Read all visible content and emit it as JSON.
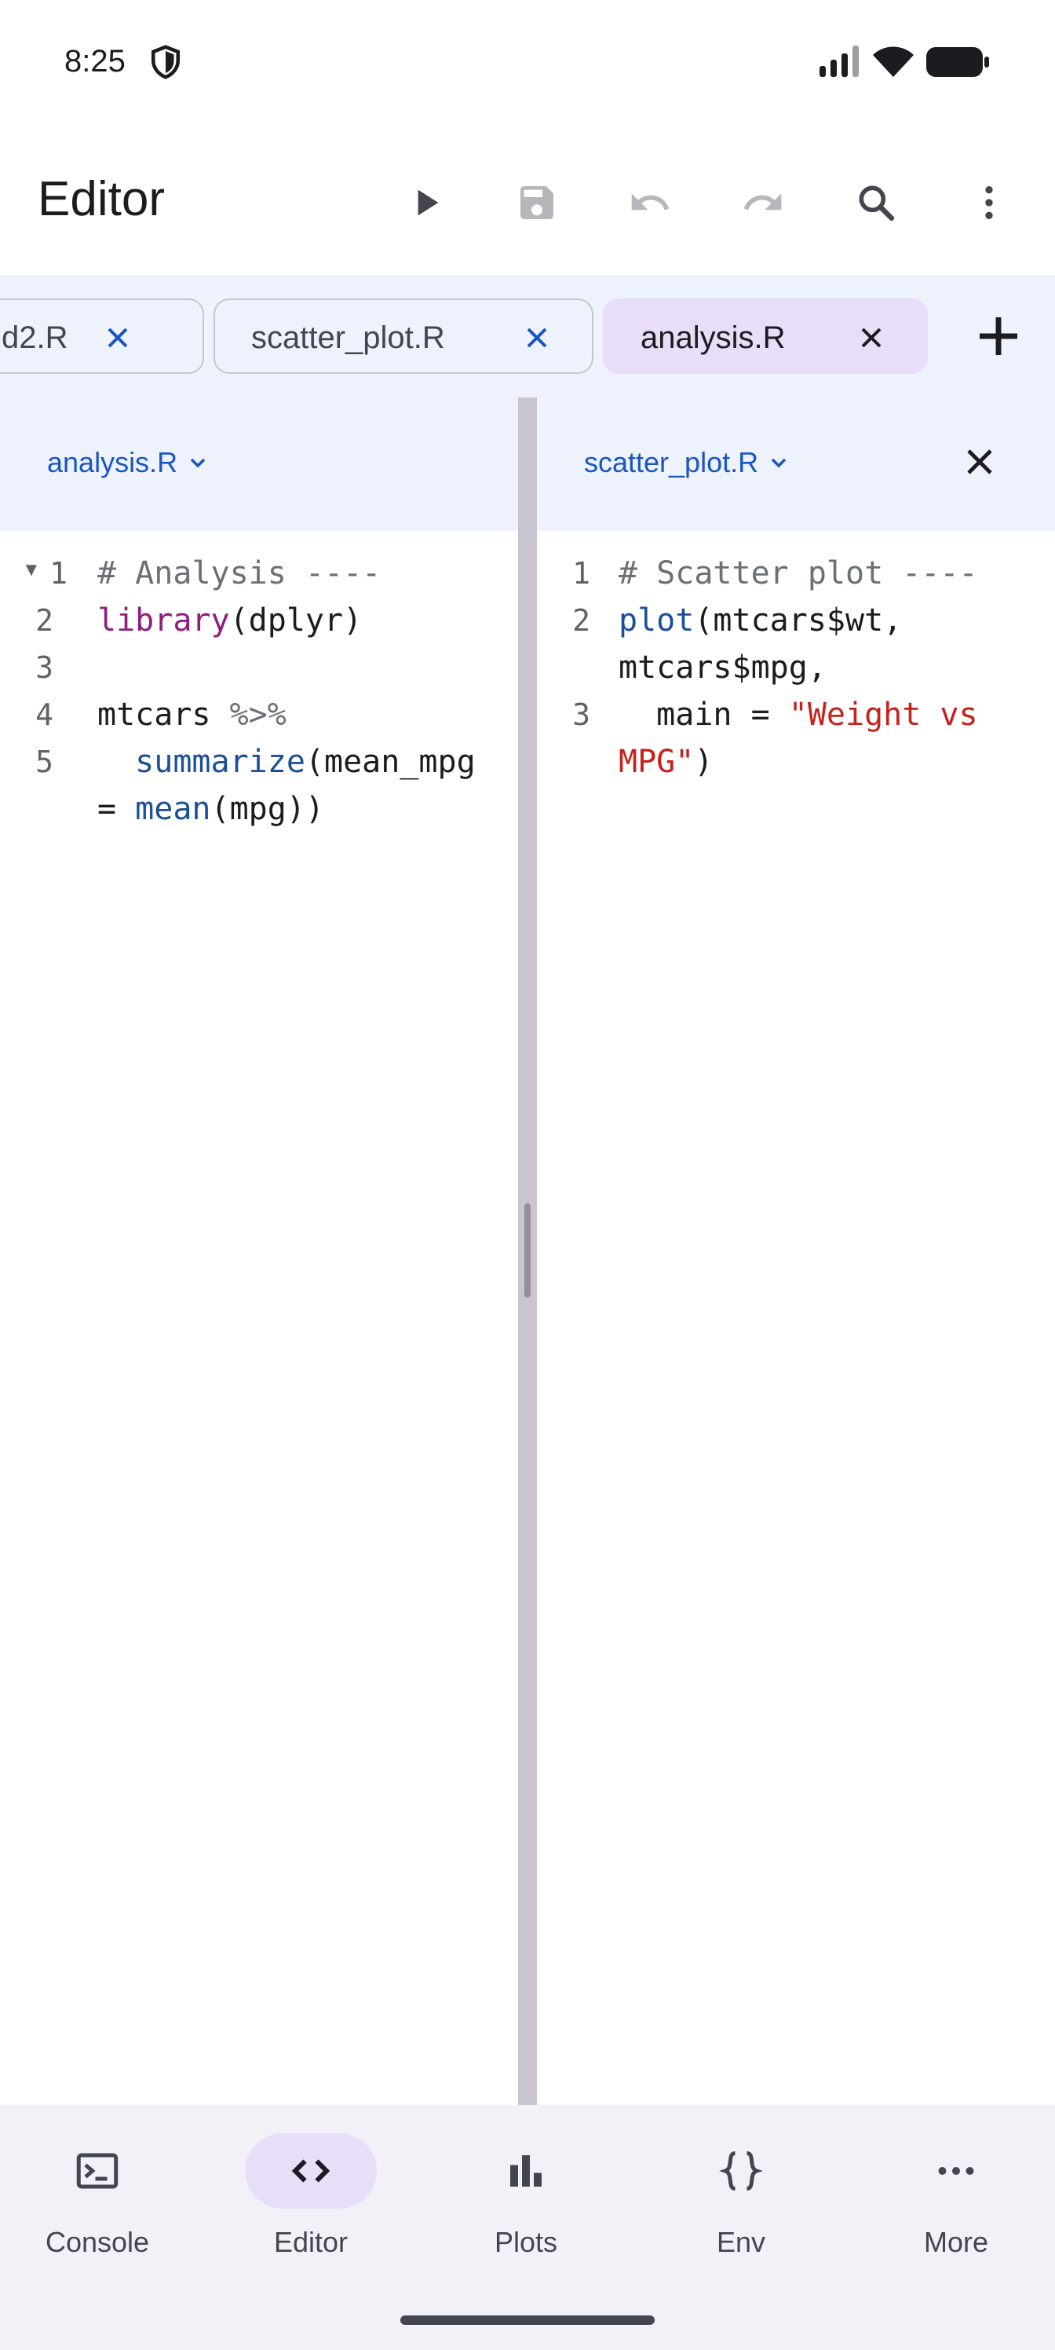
{
  "status_bar": {
    "time": "8:25",
    "icons": [
      "shield-icon",
      "signal-icon",
      "wifi-icon",
      "battery-icon"
    ]
  },
  "app_bar": {
    "title": "Editor",
    "actions": [
      "run-icon",
      "save-icon",
      "undo-icon",
      "redo-icon",
      "search-icon",
      "more-vert-icon"
    ]
  },
  "tabs": [
    {
      "label": "d2.R",
      "active": false
    },
    {
      "label": "scatter_plot.R",
      "active": false
    },
    {
      "label": "analysis.R",
      "active": true
    }
  ],
  "left_pane": {
    "file": "analysis.R",
    "lines": [
      {
        "num": "1",
        "text": "# Analysis ----"
      },
      {
        "num": "2",
        "text": "library(dplyr)"
      },
      {
        "num": "3",
        "text": ""
      },
      {
        "num": "4",
        "text": "mtcars %>%"
      },
      {
        "num": "5",
        "text": "  summarize(mean_mpg = mean(mpg))"
      }
    ]
  },
  "right_pane": {
    "file": "scatter_plot.R",
    "lines": [
      {
        "num": "1",
        "text": "# Scatter plot ----"
      },
      {
        "num": "2",
        "text": "plot(mtcars$wt, mtcars$mpg,"
      },
      {
        "num": "3",
        "text": "  main = \"Weight vs MPG\")"
      }
    ]
  },
  "bottom_nav": {
    "items": [
      {
        "label": "Console",
        "icon": "console-icon",
        "active": false
      },
      {
        "label": "Editor",
        "icon": "code-icon",
        "active": true
      },
      {
        "label": "Plots",
        "icon": "bar-chart-icon",
        "active": false
      },
      {
        "label": "Env",
        "icon": "braces-icon",
        "active": false
      },
      {
        "label": "More",
        "icon": "more-horiz-icon",
        "active": false
      }
    ]
  },
  "colors": {
    "accent": "#1a56c2",
    "active_tab": "#e8def8",
    "comment": "#6b6f76",
    "string": "#c6221c",
    "function": "#1b4f99",
    "library_fn": "#8e1e7c"
  }
}
